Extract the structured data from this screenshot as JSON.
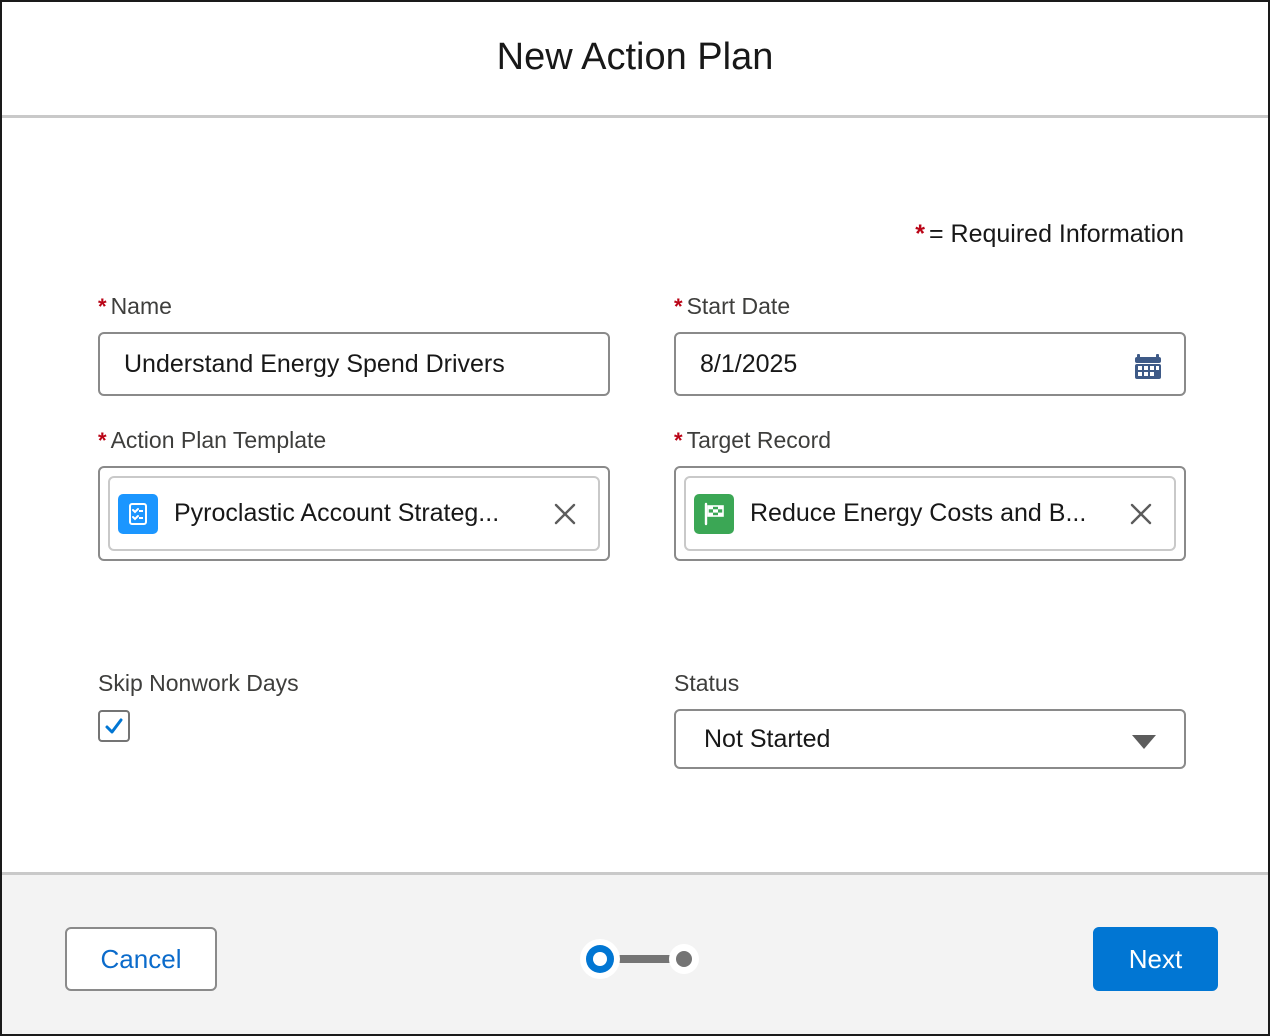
{
  "header": {
    "title": "New Action Plan"
  },
  "required_note": {
    "star": "*",
    "text": "= Required Information"
  },
  "fields": {
    "name": {
      "label": "Name",
      "value": "Understand Energy Spend Drivers",
      "required": true
    },
    "start_date": {
      "label": "Start Date",
      "value": "8/1/2025",
      "required": true,
      "icon": "calendar-icon"
    },
    "template": {
      "label": "Action Plan Template",
      "value": "Pyroclastic Account Strateg...",
      "required": true,
      "icon": "action-plan-template-icon",
      "icon_color": "#1b96ff"
    },
    "target_record": {
      "label": "Target Record",
      "value": "Reduce Energy Costs and B...",
      "required": true,
      "icon": "flag-icon",
      "icon_color": "#3ba755"
    },
    "skip_nonwork_days": {
      "label": "Skip Nonwork Days",
      "checked": true
    },
    "status": {
      "label": "Status",
      "value": "Not Started"
    }
  },
  "footer": {
    "cancel_label": "Cancel",
    "next_label": "Next",
    "progress": {
      "current_step": 1,
      "total_steps": 2
    }
  },
  "colors": {
    "brand": "#0176d3",
    "required": "#ba0517"
  }
}
